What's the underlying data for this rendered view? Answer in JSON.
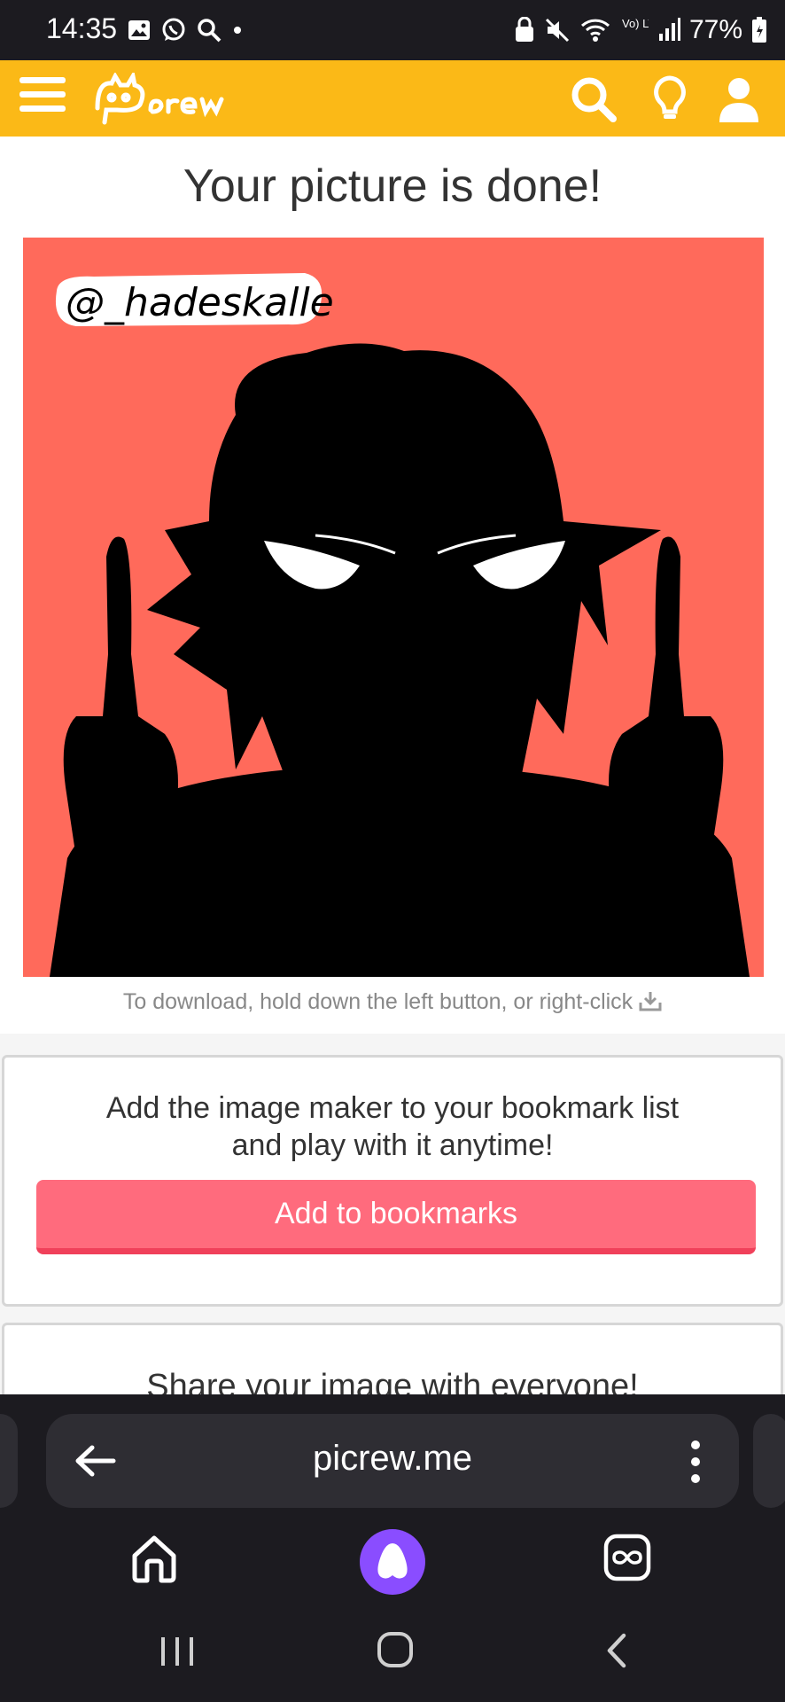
{
  "status_bar": {
    "time": "14:35",
    "battery": "77%",
    "network": "Vo) LTE1",
    "icons": [
      "gallery-icon",
      "whatsapp-icon",
      "search-icon",
      "dot-icon",
      "lock-icon",
      "mute-icon",
      "wifi-icon",
      "signal-icon",
      "battery-icon"
    ]
  },
  "header": {
    "logo_text": "picrew",
    "icons": [
      "menu-icon",
      "search-icon",
      "lightbulb-icon",
      "user-icon"
    ],
    "accent_color": "#fbb917"
  },
  "result": {
    "title": "Your picture is done!",
    "image_signature": "@_hadeskalle",
    "image_bg_color": "#ff6a5b",
    "download_hint": "To download, hold down the left button, or right-click"
  },
  "bookmark_card": {
    "text_line1": "Add the image maker to your bookmark list",
    "text_line2": "and play with it anytime!",
    "button_label": "Add to bookmarks",
    "button_color": "#ff6b7d"
  },
  "share_card": {
    "text": "Share your image with everyone!"
  },
  "browser": {
    "url": "picrew.me",
    "icons": [
      "back-arrow-icon",
      "more-options-icon",
      "home-icon",
      "assistant-icon",
      "tabs-icon"
    ]
  },
  "system_nav": {
    "icons": [
      "recents-icon",
      "home-circle-icon",
      "back-chevron-icon"
    ]
  }
}
